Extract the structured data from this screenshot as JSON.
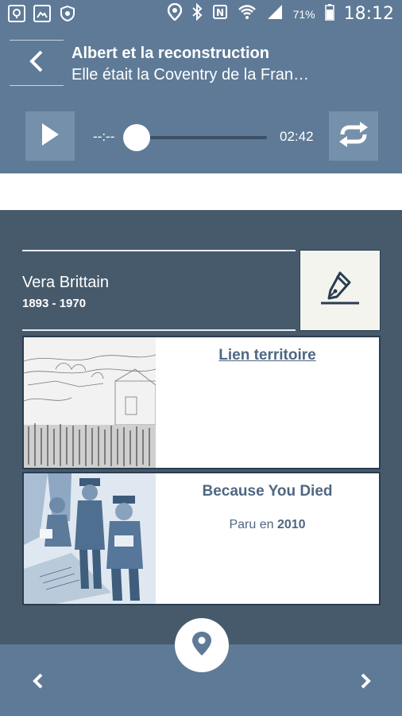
{
  "status_bar": {
    "battery_percent": "71%",
    "time": "18:12",
    "icons": [
      "notification-icon",
      "image-icon",
      "shield-icon",
      "location-icon",
      "bluetooth-icon",
      "nfc-icon",
      "wifi-icon",
      "signal-icon",
      "battery-icon"
    ]
  },
  "header": {
    "title": "Albert et la reconstruction",
    "subtitle": "Elle était la Coventry de la Fran…"
  },
  "player": {
    "elapsed": "--:--",
    "total": "02:42",
    "progress": 0
  },
  "author": {
    "name": "Vera Brittain",
    "dates": "1893 - 1970"
  },
  "cards": {
    "link": {
      "label": "Lien territoire"
    },
    "book": {
      "title": "Because You Died",
      "published_prefix": "Paru en",
      "year": "2010"
    }
  },
  "colors": {
    "primary": "#5e7a97",
    "background": "#475a6c",
    "accent_text": "#4e6782"
  }
}
